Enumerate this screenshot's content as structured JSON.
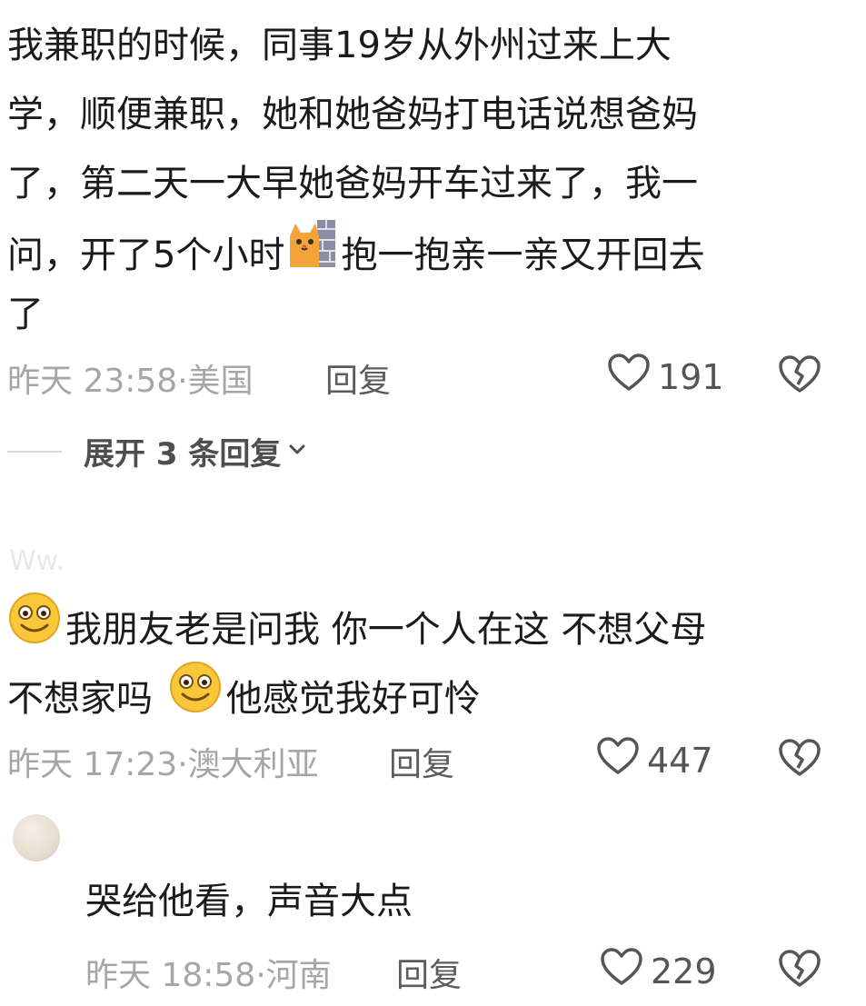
{
  "comment1": {
    "lines": [
      "我兼职的时候，同事19岁从外州过来上大",
      "学，顺便兼职，她和她爸妈打电话说想爸妈",
      "了，第二天一大早她爸妈开车过来了，我一",
      "问，开了5个小时",
      "抱一抱亲一亲又开回去",
      "了"
    ],
    "emoji_icon": "cat-peeking-behind-wall",
    "time": "昨天 23:58",
    "location": "美国",
    "reply_label": "回复",
    "likes": "191",
    "expand_label": "展开 3 条回复"
  },
  "comment2": {
    "username": "Ww.",
    "parts": [
      "我朋友老是问我 你一个人在这 不想父母",
      "不想家吗 ",
      "他感觉我好可怜"
    ],
    "emoji_icon": "smiling-face",
    "time": "昨天 17:23",
    "location": "澳大利亚",
    "reply_label": "回复",
    "likes": "447"
  },
  "reply": {
    "text": "哭给他看，声音大点",
    "time": "昨天 18:58",
    "location": "河南",
    "reply_label": "回复",
    "likes": "229"
  },
  "icons": {
    "like": "heart-outline-icon",
    "dislike": "broken-heart-icon"
  },
  "colors": {
    "text": "#1b1b1b",
    "meta": "#a6a6a6",
    "icon": "#555555"
  }
}
